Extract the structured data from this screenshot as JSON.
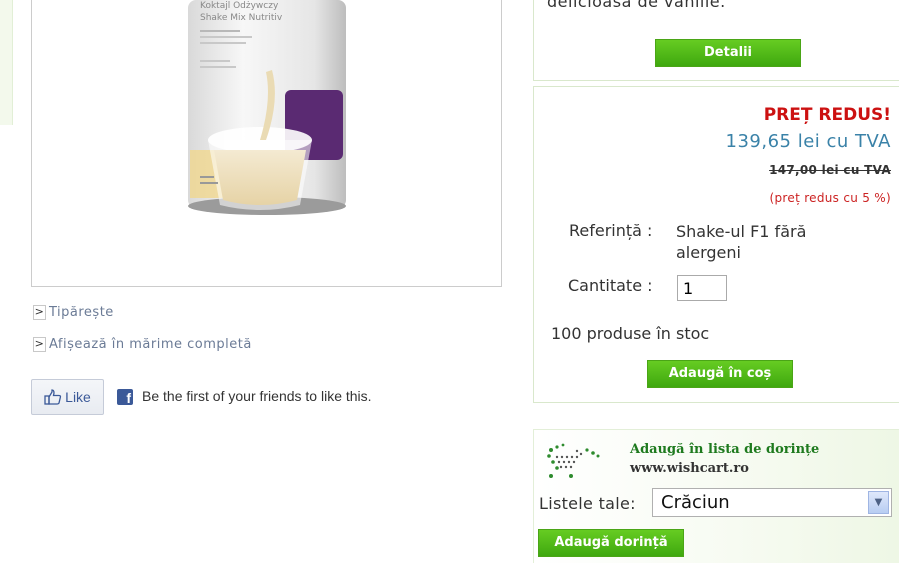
{
  "left": {
    "print_label": "Tipărește",
    "fullsize_label": "Afișează în mărime completă",
    "like_label": "Like",
    "facebook_text": "Be the first of your friends to like this."
  },
  "product_image": {
    "label_line1": "Koktajl Odżywczy",
    "label_line2": "Shake Mix Nutritiv"
  },
  "top_panel": {
    "description_tail": "delicioasă de vanilie.",
    "details_label": "Detalii"
  },
  "price_panel": {
    "title": "PREȚ REDUS!",
    "price_now": "139,65 lei cu TVA",
    "price_old": "147,00 lei cu TVA",
    "discount": "(preț redus cu 5 %)",
    "reference_label": "Referință :",
    "reference_value": "Shake-ul F1 fără alergeni",
    "quantity_label": "Cantitate :",
    "quantity_value": "1",
    "stock_text": "100 produse în stoc",
    "add_to_cart_label": "Adaugă în coș"
  },
  "wishlist_panel": {
    "title": "Adaugă în lista de dorințe",
    "site": "www.wishcart.ro",
    "lists_label": "Listele tale:",
    "selected_list": "Crăciun",
    "add_wish_label": "Adaugă dorință"
  },
  "colors": {
    "accent_green": "#4cb315",
    "price_red": "#cc1111",
    "price_blue": "#3a82a8"
  }
}
